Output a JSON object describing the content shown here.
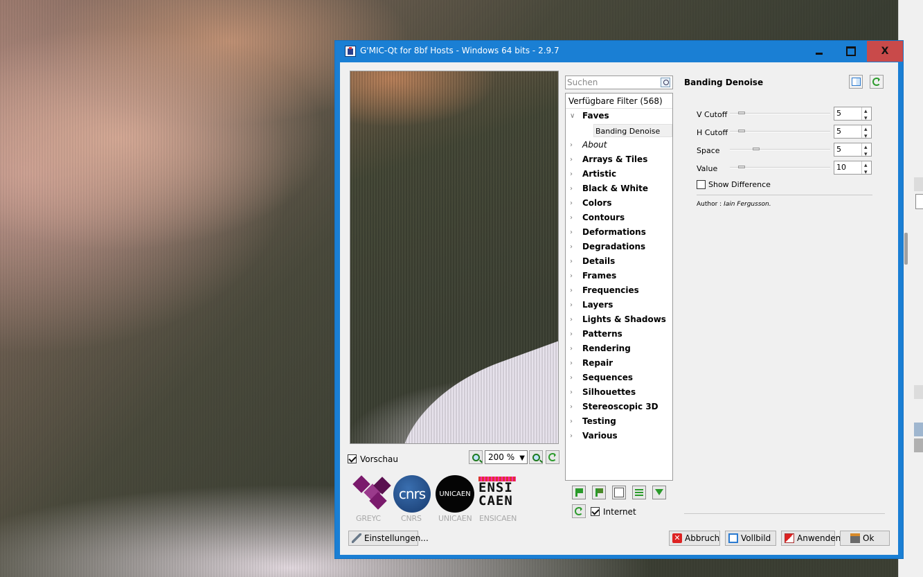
{
  "window": {
    "title": "G'MIC-Qt for 8bf Hosts - Windows 64 bits - 2.9.7",
    "controls": {
      "close": "X"
    }
  },
  "preview": {
    "checkbox_label": "Vorschau",
    "checked": true,
    "zoom_value": "200 %"
  },
  "logos": [
    {
      "name": "GREYC",
      "caption": "GREYC"
    },
    {
      "name": "CNRS",
      "caption": "CNRS",
      "mark": "cnrs"
    },
    {
      "name": "UNICAEN",
      "caption": "UNICAEN",
      "mark": "UNICAEN"
    },
    {
      "name": "ENSICAEN",
      "caption": "ENSICAEN",
      "mark_line1": "ENSI",
      "mark_line2": "CAEN"
    }
  ],
  "settings_button": "Einstellungen...",
  "search": {
    "placeholder": "Suchen"
  },
  "filters": {
    "header": "Verfügbare Filter (568)",
    "items": [
      {
        "label": "Faves",
        "expanded": true,
        "italic": false
      },
      {
        "label": "About",
        "expanded": false,
        "italic": true
      },
      {
        "label": "Arrays & Tiles",
        "expanded": false,
        "italic": false
      },
      {
        "label": "Artistic",
        "expanded": false,
        "italic": false
      },
      {
        "label": "Black & White",
        "expanded": false,
        "italic": false
      },
      {
        "label": "Colors",
        "expanded": false,
        "italic": false
      },
      {
        "label": "Contours",
        "expanded": false,
        "italic": false
      },
      {
        "label": "Deformations",
        "expanded": false,
        "italic": false
      },
      {
        "label": "Degradations",
        "expanded": false,
        "italic": false
      },
      {
        "label": "Details",
        "expanded": false,
        "italic": false
      },
      {
        "label": "Frames",
        "expanded": false,
        "italic": false
      },
      {
        "label": "Frequencies",
        "expanded": false,
        "italic": false
      },
      {
        "label": "Layers",
        "expanded": false,
        "italic": false
      },
      {
        "label": "Lights & Shadows",
        "expanded": false,
        "italic": false
      },
      {
        "label": "Patterns",
        "expanded": false,
        "italic": false
      },
      {
        "label": "Rendering",
        "expanded": false,
        "italic": false
      },
      {
        "label": "Repair",
        "expanded": false,
        "italic": false
      },
      {
        "label": "Sequences",
        "expanded": false,
        "italic": false
      },
      {
        "label": "Silhouettes",
        "expanded": false,
        "italic": false
      },
      {
        "label": "Stereoscopic 3D",
        "expanded": false,
        "italic": false
      },
      {
        "label": "Testing",
        "expanded": false,
        "italic": false
      },
      {
        "label": "Various",
        "expanded": false,
        "italic": false
      }
    ],
    "selected_fave": "Banding Denoise",
    "internet_label": "Internet",
    "internet_checked": true
  },
  "filter_params": {
    "title": "Banding Denoise",
    "params": [
      {
        "label": "V Cutoff",
        "value": "5",
        "level": 0.1
      },
      {
        "label": "H Cutoff",
        "value": "5",
        "level": 0.1
      },
      {
        "label": "Space",
        "value": "5",
        "level": 0.25
      },
      {
        "label": "Value",
        "value": "10",
        "level": 0.1
      }
    ],
    "show_difference_label": "Show Difference",
    "show_difference_checked": false,
    "author_label": "Author : ",
    "author_name": "Iain Fergusson."
  },
  "buttons": {
    "cancel": "Abbruch",
    "fullscreen": "Vollbild",
    "apply": "Anwenden",
    "ok": "Ok"
  }
}
